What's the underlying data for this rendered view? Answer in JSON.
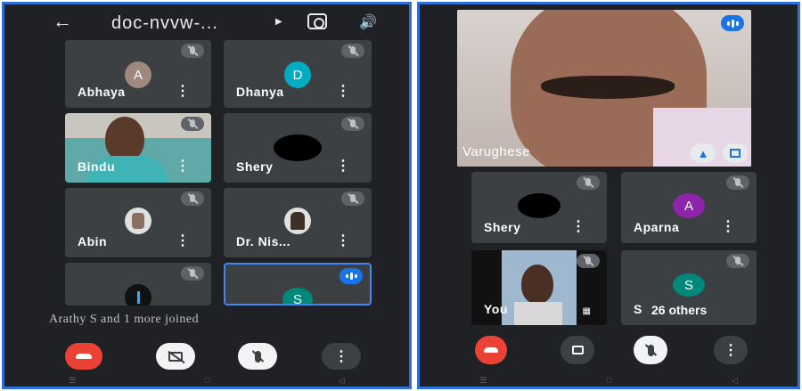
{
  "left_screen": {
    "title": "doc-nvvw-...",
    "participants": [
      {
        "name": "Abhaya",
        "initial": "A",
        "avatar_color": "#a1887f"
      },
      {
        "name": "Dhanya",
        "initial": "D",
        "avatar_color": "#00acc1"
      },
      {
        "name": "Bindu"
      },
      {
        "name": "Shery"
      },
      {
        "name": "Abin"
      },
      {
        "name": "Dr. Nis..."
      },
      {
        "name": ""
      },
      {
        "name": "",
        "initial": "S",
        "avatar_color": "#00897b"
      }
    ],
    "join_banner": "Arathy S and 1 more joined"
  },
  "right_screen": {
    "pinned": {
      "name": "Varughese"
    },
    "participants": [
      {
        "name": "Shery"
      },
      {
        "name": "Aparna",
        "initial": "A",
        "avatar_color": "#8e24aa"
      },
      {
        "name": "You"
      },
      {
        "name": "S",
        "initial": "S",
        "avatar_color": "#00897b",
        "overlay": "26 others"
      }
    ]
  },
  "icons": {
    "back": "arrow-back-icon",
    "end_call": "phone-hangup-icon",
    "camera_off": "video-off-icon",
    "mic_off": "mic-off-icon",
    "more": "more-vert-icon"
  },
  "colors": {
    "background": "#202124",
    "tile": "#3c4043",
    "end_call": "#ea4335",
    "frame": "#2f6fd6",
    "speaking": "#1a73e8"
  }
}
